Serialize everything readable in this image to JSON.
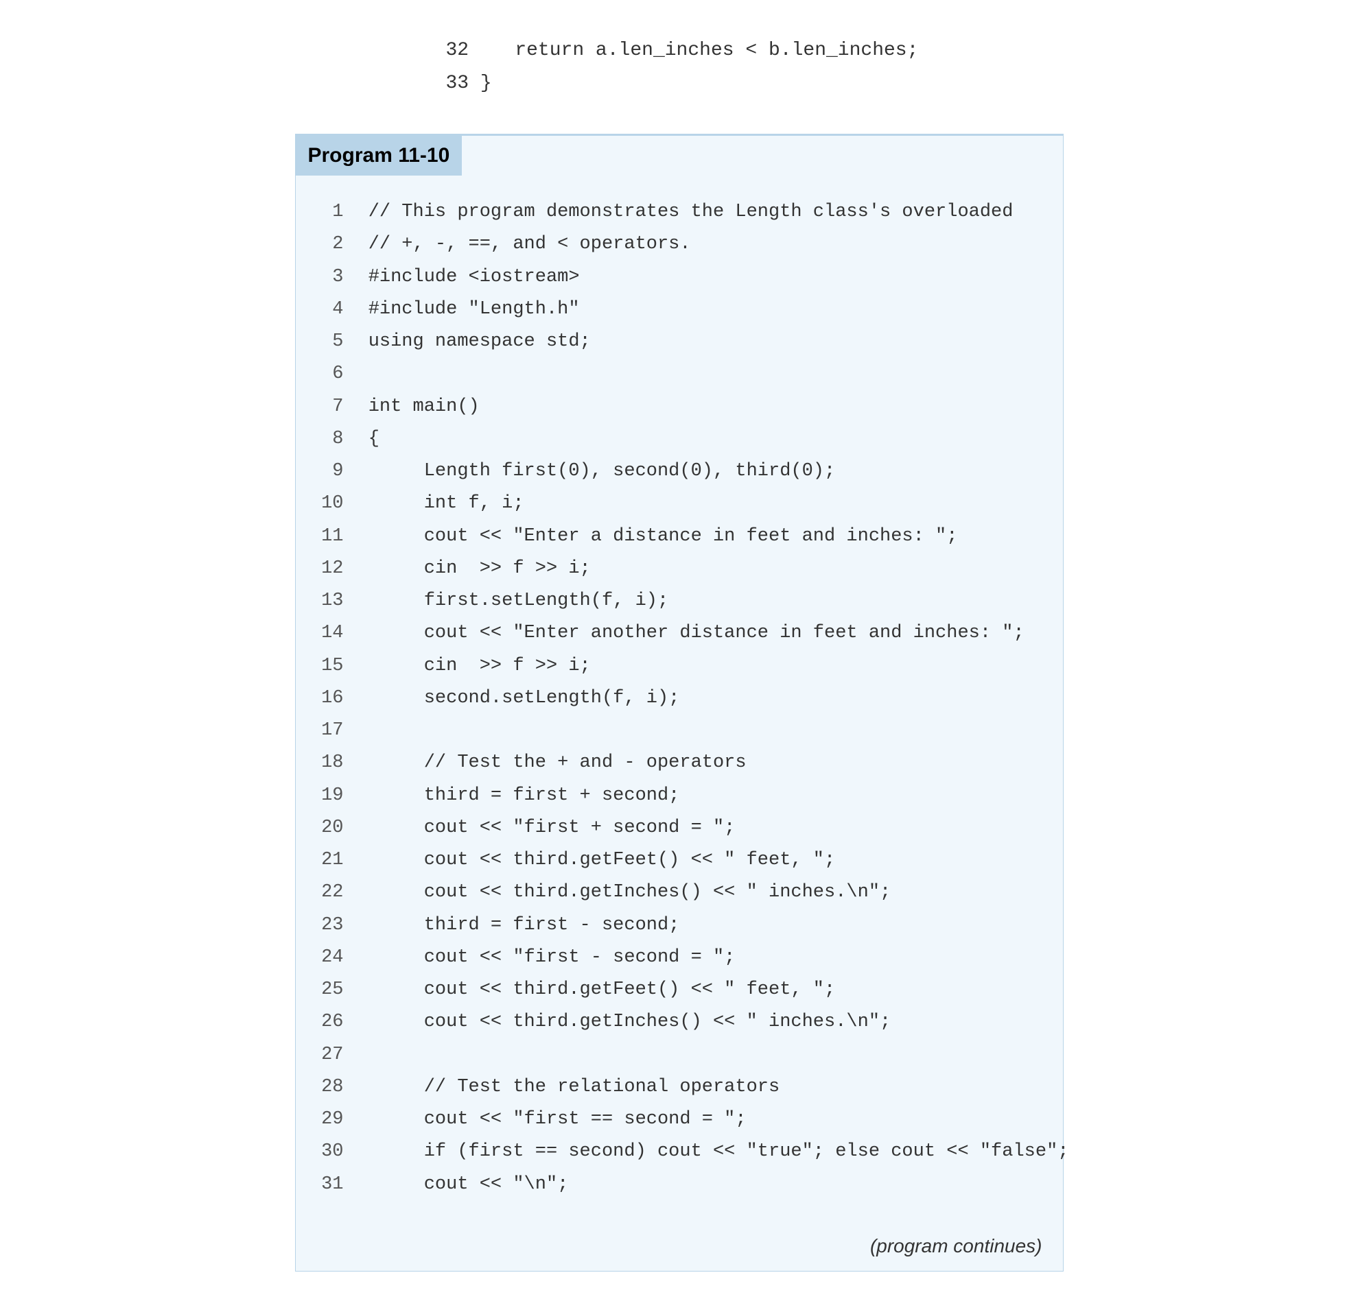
{
  "top_code": {
    "lines": [
      {
        "number": "32",
        "content": "    return a.len_inches < b.len_inches;"
      },
      {
        "number": "33",
        "content": "}"
      }
    ]
  },
  "program_box": {
    "title": "Program 11-10",
    "lines": [
      {
        "number": "1",
        "content": " // This program demonstrates the Length class's overloaded"
      },
      {
        "number": "2",
        "content": " // +, -, ==, and < operators."
      },
      {
        "number": "3",
        "content": " #include <iostream>"
      },
      {
        "number": "4",
        "content": " #include \"Length.h\""
      },
      {
        "number": "5",
        "content": " using namespace std;"
      },
      {
        "number": "6",
        "content": ""
      },
      {
        "number": "7",
        "content": " int main()"
      },
      {
        "number": "8",
        "content": " {"
      },
      {
        "number": "9",
        "content": "      Length first(0), second(0), third(0);"
      },
      {
        "number": "10",
        "content": "      int f, i;"
      },
      {
        "number": "11",
        "content": "      cout << \"Enter a distance in feet and inches: \";"
      },
      {
        "number": "12",
        "content": "      cin  >> f >> i;"
      },
      {
        "number": "13",
        "content": "      first.setLength(f, i);"
      },
      {
        "number": "14",
        "content": "      cout << \"Enter another distance in feet and inches: \";"
      },
      {
        "number": "15",
        "content": "      cin  >> f >> i;"
      },
      {
        "number": "16",
        "content": "      second.setLength(f, i);"
      },
      {
        "number": "17",
        "content": ""
      },
      {
        "number": "18",
        "content": "      // Test the + and - operators"
      },
      {
        "number": "19",
        "content": "      third = first + second;"
      },
      {
        "number": "20",
        "content": "      cout << \"first + second = \";"
      },
      {
        "number": "21",
        "content": "      cout << third.getFeet() << \" feet, \";"
      },
      {
        "number": "22",
        "content": "      cout << third.getInches() << \" inches.\\n\";"
      },
      {
        "number": "23",
        "content": "      third = first - second;"
      },
      {
        "number": "24",
        "content": "      cout << \"first - second = \";"
      },
      {
        "number": "25",
        "content": "      cout << third.getFeet() << \" feet, \";"
      },
      {
        "number": "26",
        "content": "      cout << third.getInches() << \" inches.\\n\";"
      },
      {
        "number": "27",
        "content": ""
      },
      {
        "number": "28",
        "content": "      // Test the relational operators"
      },
      {
        "number": "29",
        "content": "      cout << \"first == second = \";"
      },
      {
        "number": "30",
        "content": "      if (first == second) cout << \"true\"; else cout << \"false\";"
      },
      {
        "number": "31",
        "content": "      cout << \"\\n\";"
      }
    ],
    "program_continues": "(program continues)"
  }
}
